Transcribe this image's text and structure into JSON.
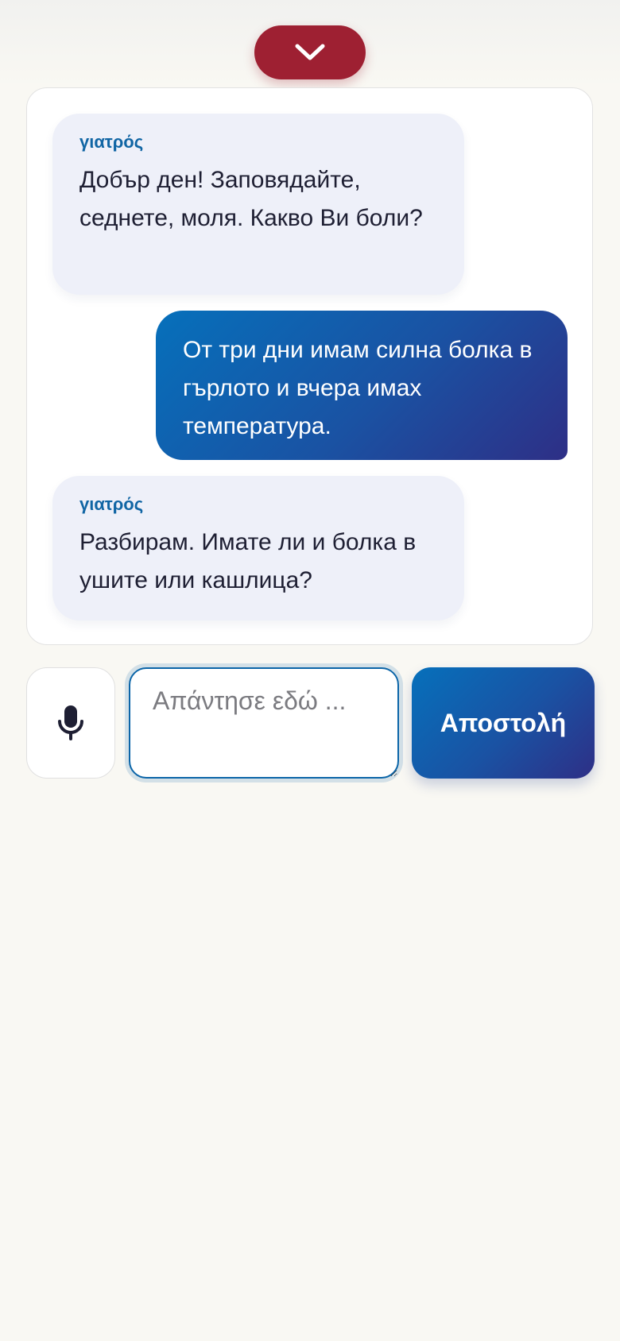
{
  "controls": {
    "collapse_icon": "chevron-down-icon",
    "mic_icon": "microphone-icon",
    "input_placeholder": "Απάντησε εδώ ...",
    "input_value": "",
    "send_label": "Αποστολή"
  },
  "messages": [
    {
      "role": "doctor",
      "sender": "γιατρός",
      "text": "Добър ден! Заповядайте, седнете, моля. Какво Ви боли?"
    },
    {
      "role": "user",
      "text": "От три дни имам силна болка в гърлото и вчера имах температура."
    },
    {
      "role": "doctor",
      "sender": "γιατρός",
      "text": "Разбирам. Имате ли и болка в ушите или кашлица?"
    }
  ],
  "colors": {
    "page_background": "#f9f8f3",
    "collapse_button": "#9e2032",
    "doctor_bubble": "#eef0f9",
    "sender_label": "#1065a4",
    "primary_gradient_start": "#0670bb",
    "primary_gradient_end": "#2e2f86",
    "text_dark": "#1e1f33"
  }
}
